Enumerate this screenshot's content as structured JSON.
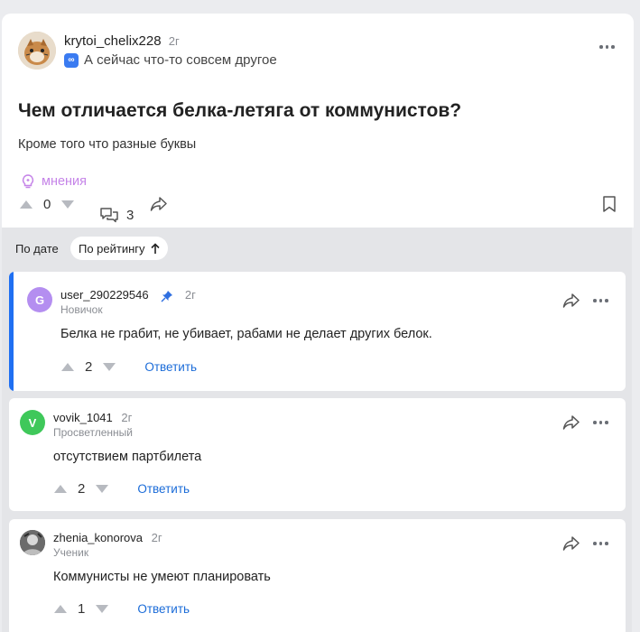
{
  "post": {
    "author": "krytoi_chelix228",
    "time": "2г",
    "status_badge": "∞",
    "status": "А сейчас что-то совсем другое",
    "title": "Чем отличается белка-летяга от коммунистов?",
    "body": "Кроме того что разные буквы",
    "opinions_label": "мнения",
    "votes": "0",
    "comments_count": "3"
  },
  "sort": {
    "by_date": "По дате",
    "by_rating": "По рейтингу"
  },
  "comments": [
    {
      "initial": "G",
      "avatar_color": "#b48ef0",
      "author": "user_290229546",
      "time": "2г",
      "rank": "Новичок",
      "text": "Белка не грабит, не убивает, рабами не делает других белок.",
      "votes": "2",
      "reply": "Ответить",
      "pinned": true
    },
    {
      "initial": "V",
      "avatar_color": "#3fc85a",
      "author": "vovik_1041",
      "time": "2г",
      "rank": "Просветленный",
      "text": "отсутствием партбилета",
      "votes": "2",
      "reply": "Ответить",
      "pinned": false
    },
    {
      "initial": "",
      "avatar_color": "#555555",
      "author": "zhenia_konorova",
      "time": "2г",
      "rank": "Ученик",
      "text": "Коммунисты не умеют планировать",
      "votes": "1",
      "reply": "Ответить",
      "pinned": false
    }
  ],
  "colors": {
    "accent": "#1f6ff2",
    "link": "#1a6bd8",
    "opinions": "#c584e8"
  }
}
